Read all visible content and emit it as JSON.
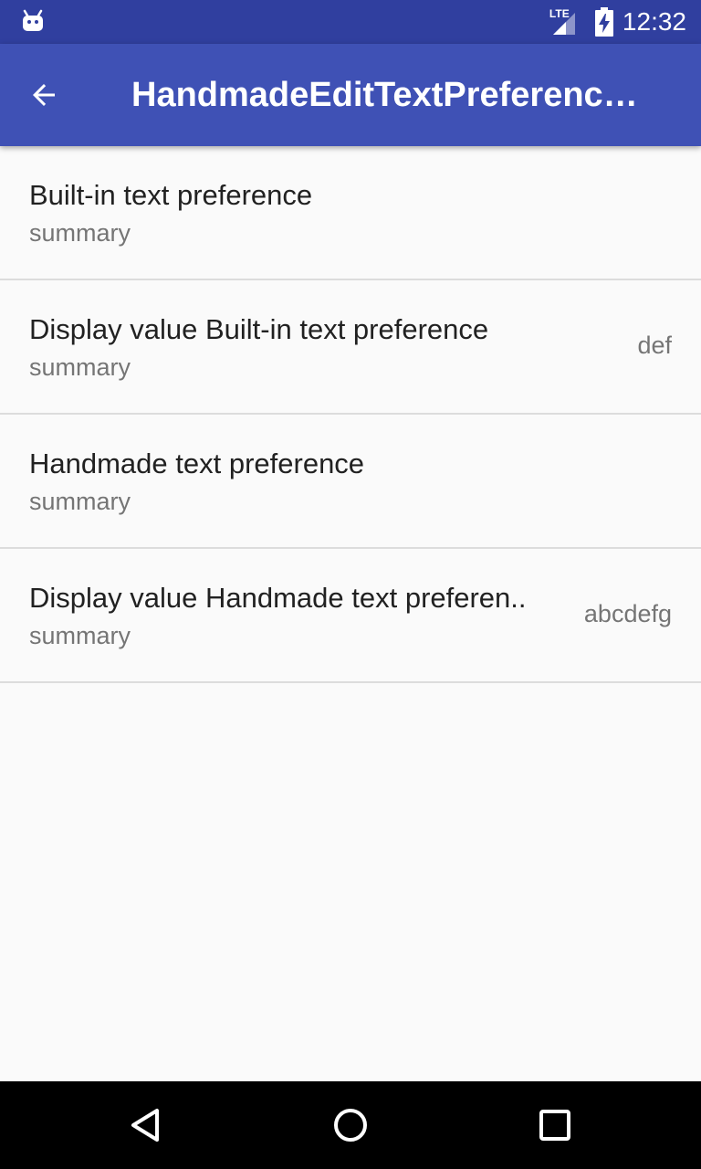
{
  "status_bar": {
    "network": "LTE",
    "time": "12:32"
  },
  "app_bar": {
    "title": "HandmadeEditTextPreference…",
    "back_icon": "arrow-back-icon"
  },
  "preferences": [
    {
      "title": "Built-in text preference",
      "summary": "summary",
      "value": ""
    },
    {
      "title": "Display value Built-in text preference",
      "summary": "summary",
      "value": "def"
    },
    {
      "title": "Handmade text preference",
      "summary": "summary",
      "value": ""
    },
    {
      "title": "Display value Handmade text preferen..",
      "summary": "summary",
      "value": "abcdefg"
    }
  ],
  "colors": {
    "status_bar": "#303f9f",
    "app_bar": "#3f51b5",
    "background": "#fafafa"
  }
}
